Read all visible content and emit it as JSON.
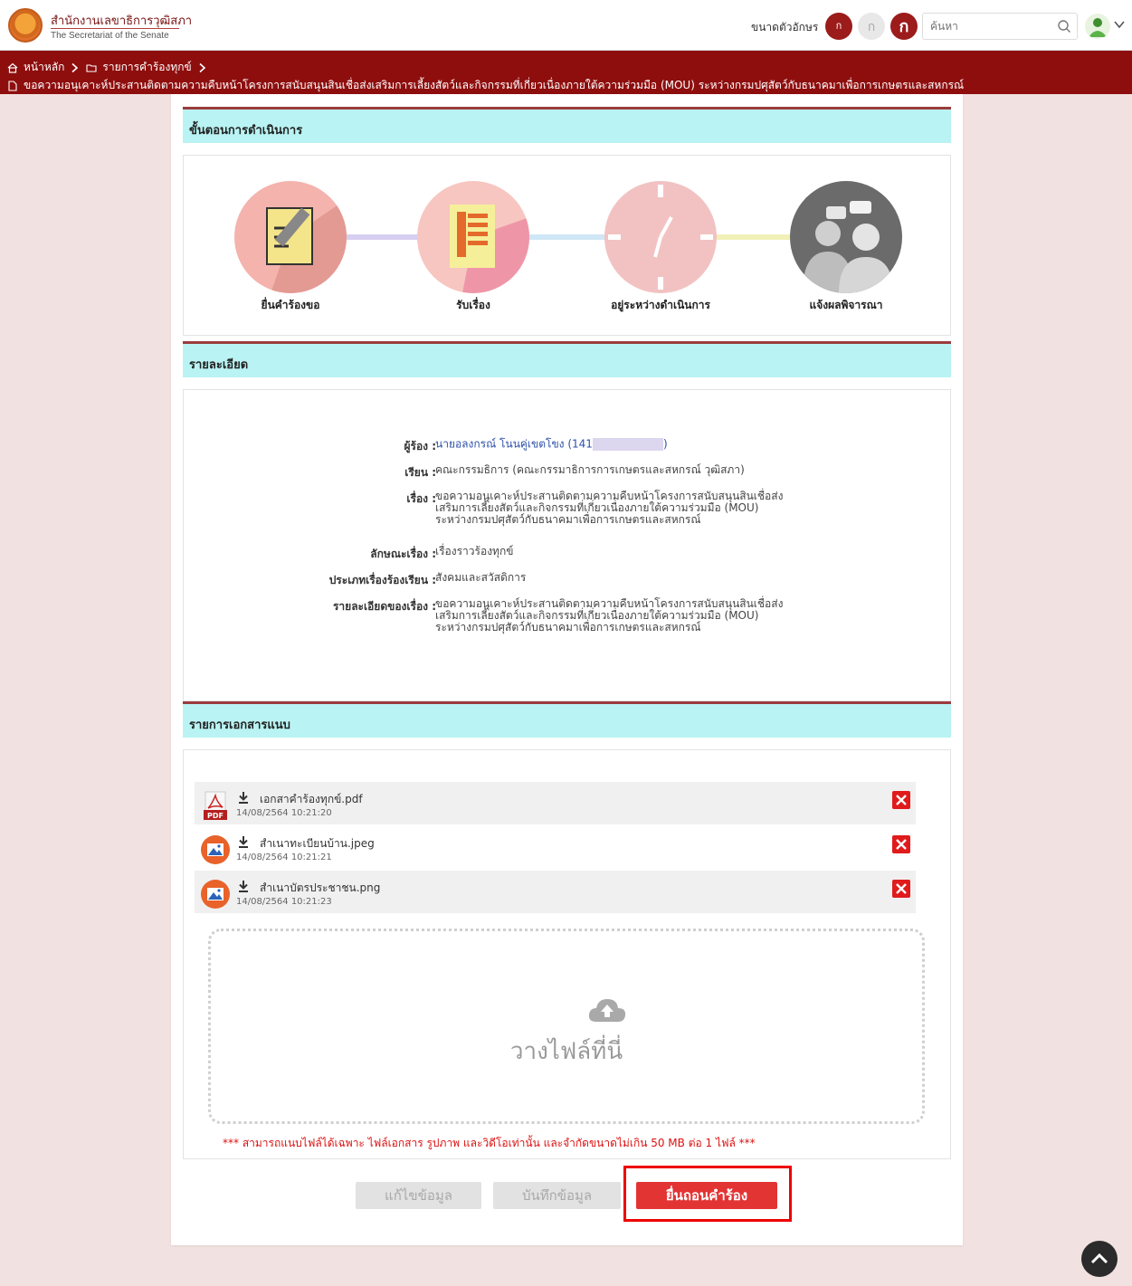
{
  "header": {
    "org_name_th": "สำนักงานเลขาธิการวุฒิสภา",
    "org_name_en": "The Secretariat of the Senate",
    "font_size_label": "ขนาดตัวอักษร",
    "font_small": "ก",
    "font_medium": "ก",
    "font_large": "ก",
    "search_placeholder": "ค้นหา"
  },
  "breadcrumb": {
    "home": "หน้าหลัก",
    "list": "รายการคำร้องทุกข์",
    "current": "ขอความอนุเคาะห์ประสานติดตามความคืบหน้าโครงการสนับสนุนสินเชื่อส่งเสริมการเลี้ยงสัตว์และกิจกรรมที่เกี่ยวเนื่องภายใต้ความร่วมมือ (MOU) ระหว่างกรมปศุสัตว์กับธนาคมาเพื่อการเกษตรและสหกรณ์"
  },
  "sections": {
    "steps_title": "ขั้นตอนการดำเนินการ",
    "details_title": "รายละเอียด",
    "attachments_title": "รายการเอกสารแนบ"
  },
  "steps": [
    {
      "label": "ยื่นคำร้องขอ"
    },
    {
      "label": "รับเรื่อง"
    },
    {
      "label": "อยู่ระหว่างดำเนินการ"
    },
    {
      "label": "แจ้งผลพิจารณา"
    }
  ],
  "details": {
    "complainant_label": "ผู้ร้อง :",
    "complainant_value": "นายอลงกรณ์ โนนคู่เขตโขง (141",
    "complainant_suffix": ")",
    "to_label": "เรียน :",
    "to_value": "คณะกรรมธิการ (คณะกรรมาธิการการเกษตรและสหกรณ์ วุฒิสภา)",
    "subject_label": "เรื่อง :",
    "subject_value": "ขอความอนุเคาะห์ประสานติดตามความคืบหน้าโครงการสนับสนุนสินเชื่อส่งเสริมการเลี้ยงสัตว์และกิจกรรมที่เกี่ยวเนื่องภายใต้ความร่วมมือ (MOU) ระหว่างกรมปศุสัตว์กับธนาคมาเพื่อการเกษตรและสหกรณ์",
    "nature_label": "ลักษณะเรื่อง :",
    "nature_value": "เรื่องราวร้องทุกข์",
    "type_label": "ประเภทเรื่องร้องเรียน :",
    "type_value": "สังคมและสวัสดิการ",
    "desc_label": "รายละเอียดของเรื่อง :",
    "desc_value": "ขอความอนุเคาะห์ประสานติดตามความคืบหน้าโครงการสนับสนุนสินเชื่อส่งเสริมการเลี้ยงสัตว์และกิจกรรมที่เกี่ยวเนื่องภายใต้ความร่วมมือ (MOU) ระหว่างกรมปศุสัตว์กับธนาคมาเพื่อการเกษตรและสหกรณ์"
  },
  "files": [
    {
      "name": "เอกสาคำร้องทุกข์.pdf",
      "date": "14/08/2564 10:21:20",
      "type": "pdf"
    },
    {
      "name": "สำเนาทะเบียนบ้าน.jpeg",
      "date": "14/08/2564 10:21:21",
      "type": "image"
    },
    {
      "name": "สำเนาบัตรประชาชน.png",
      "date": "14/08/2564 10:21:23",
      "type": "image"
    }
  ],
  "pdf_badge": "PDF",
  "dropzone_text": "วางไฟล์ที่นี่",
  "upload_note": "*** สามารถแนบไฟล์ได้เฉพาะ ไฟล์เอกสาร รูปภาพ และวิดีโอเท่านั้น และจำกัดขนาดไม่เกิน 50 MB ต่อ 1 ไฟล์ ***",
  "buttons": {
    "edit": "แก้ไขข้อมูล",
    "save": "บันทึกข้อมูล",
    "withdraw": "ยื่นถอนคำร้อง"
  },
  "colors": {
    "brand": "#8e0e0e",
    "section_header": "#b9f3f3",
    "danger": "#e33434"
  }
}
